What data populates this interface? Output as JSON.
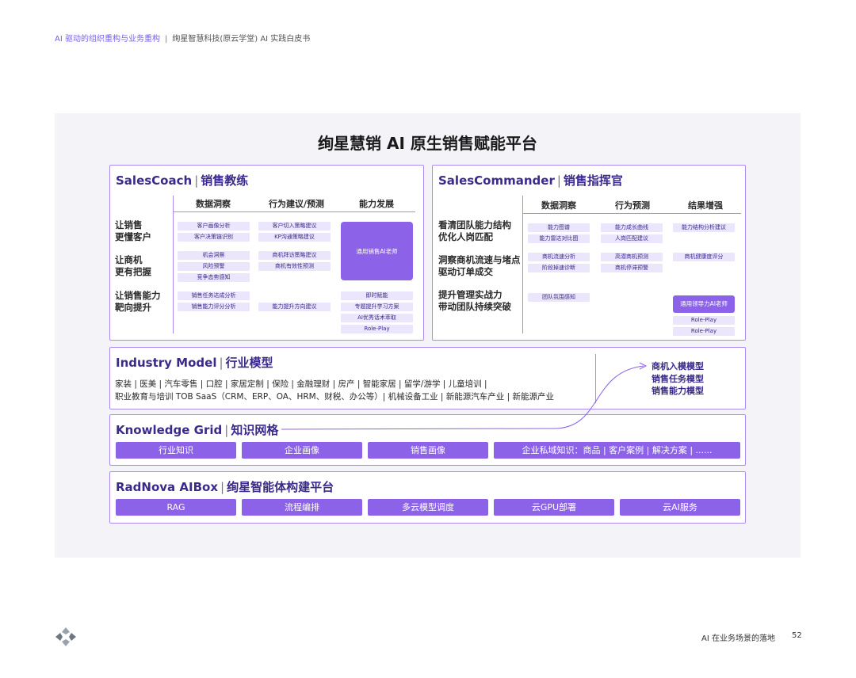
{
  "header": {
    "section": "AI 驱动的组织重构与业务重构",
    "separator": "|",
    "doc_title": "绚星智慧科技(原云学堂) AI 实践白皮书"
  },
  "diagram": {
    "title": "绚星慧销 AI 原生销售赋能平台",
    "salescoach": {
      "name": "SalesCoach",
      "bar": "|",
      "cn": "销售教练",
      "columns": [
        "数据洞察",
        "行为建议/预测",
        "能力发展"
      ],
      "rows": [
        {
          "l1": "让销售",
          "l2": "更懂客户"
        },
        {
          "l1": "让商机",
          "l2": "更有把握"
        },
        {
          "l1": "让销售能力",
          "l2": "靶向提升"
        }
      ],
      "chips_col1": [
        "客户画像分析",
        "客户决策链识别",
        "机会洞察",
        "风险预警",
        "竞争态势感知",
        "销售任务达成分析",
        "销售能力评分分析"
      ],
      "chips_col2": [
        "客户切入策略建议",
        "KP沟通策略建议",
        "商机拜访策略建议",
        "商机有效性预测",
        "能力提升方向建议"
      ],
      "chips_col3": [
        "即时赋能",
        "专题提升学习方案",
        "AI优秀话术萃取",
        "Role-Play"
      ],
      "big_chip": "通用销售AI老师"
    },
    "salescommander": {
      "name": "SalesCommander",
      "bar": "|",
      "cn": "销售指挥官",
      "columns": [
        "数据洞察",
        "行为预测",
        "结果增强"
      ],
      "rows": [
        {
          "l1": "看清团队能力结构",
          "l2": "优化人岗匹配"
        },
        {
          "l1": "洞察商机流速与堵点",
          "l2": "驱动订单成交"
        },
        {
          "l1": "提升管理实战力",
          "l2": "带动团队持续突破"
        }
      ],
      "chips_col1": [
        "能力图谱",
        "能力雷达对比图",
        "商机流速分析",
        "阶段掉速诊断",
        "团队氛围感知"
      ],
      "chips_col2": [
        "能力成长曲线",
        "人岗匹配建议",
        "高潜商机预测",
        "商机停滞预警"
      ],
      "chips_col3": [
        "能力结构分析建议",
        "商机健康度评分",
        "Role-Play",
        "Role-Play"
      ],
      "leader_chip": "通用领导力AI老师"
    },
    "industry_model": {
      "name": "Industry Model",
      "bar": "|",
      "cn": "行业模型",
      "line1": "家装 | 医美 | 汽车零售 | 口腔 | 家居定制 | 保险 | 金融理财 | 房产 | 智能家居 | 留学/游学 | 儿童培训 |",
      "line2": "职业教育与培训 TOB SaaS（CRM、ERP、OA、HRM、财税、办公等）| 机械设备工业 | 新能源汽车产业 | 新能源产业",
      "models": [
        "商机入模模型",
        "销售任务模型",
        "销售能力模型"
      ]
    },
    "knowledge_grid": {
      "name": "Knowledge Grid",
      "bar": "|",
      "cn": "知识网格",
      "items": [
        "行业知识",
        "企业画像",
        "销售画像",
        "企业私域知识：商品 | 客户案例 | 解决方案 | ......"
      ]
    },
    "radnova": {
      "name": "RadNova AIBox",
      "bar": "|",
      "cn": "绚星智能体构建平台",
      "items": [
        "RAG",
        "流程编排",
        "多云模型调度",
        "云GPU部署",
        "云AI服务"
      ]
    }
  },
  "footer": {
    "label": "AI 在业务场景的落地",
    "page": "52"
  },
  "colors": {
    "accent": "#8b62e8",
    "chip_bg": "#ece6fc",
    "border": "#a98bf3",
    "panel_bg": "#f3f3f8"
  }
}
